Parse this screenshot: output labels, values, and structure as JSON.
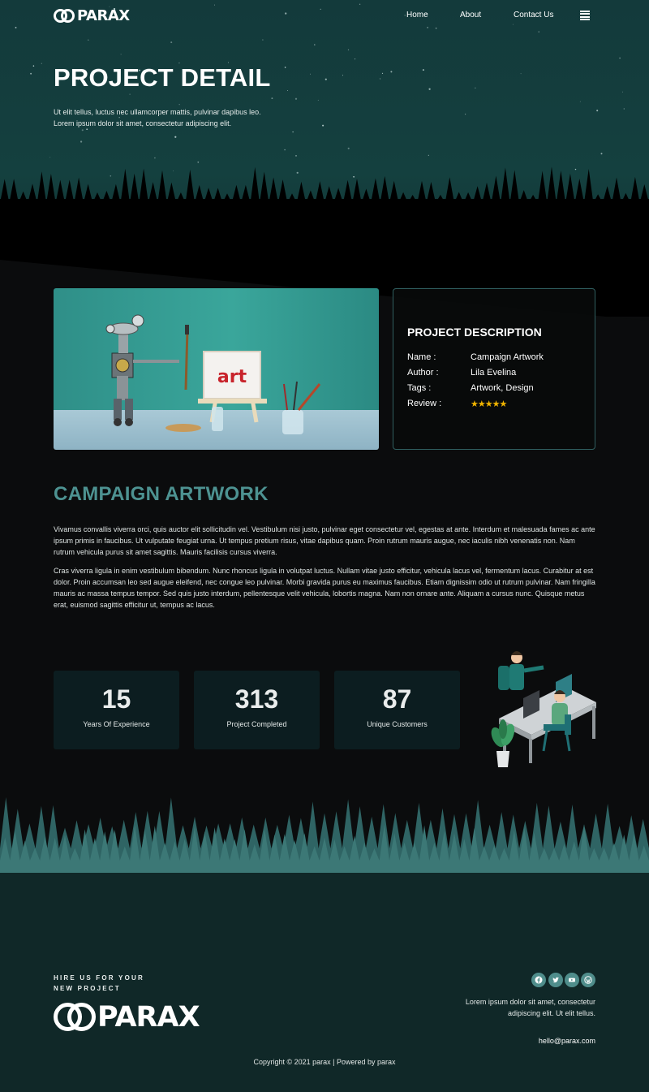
{
  "brand": {
    "name": "PARAX"
  },
  "nav": {
    "items": [
      "Home",
      "About",
      "Contact Us"
    ],
    "menu_icon": "hamburger-icon"
  },
  "hero": {
    "title": "PROJECT DETAIL",
    "subtitle_line1": "Ut elit tellus, luctus nec ullamcorper mattis, pulvinar dapibus leo.",
    "subtitle_line2": "Lorem ipsum dolor sit amet, consectetur adipiscing elit."
  },
  "project": {
    "image_text": "art",
    "description_title": "PROJECT DESCRIPTION",
    "rows": [
      {
        "key": "Name :",
        "value": "Campaign Artwork"
      },
      {
        "key": "Author :",
        "value": "Lila Evelina"
      },
      {
        "key": "Tags :",
        "value": "Artwork, Design"
      },
      {
        "key": "Review :",
        "value": "★★★★★"
      }
    ],
    "review_stars": 4.5
  },
  "article": {
    "title": "CAMPAIGN ARTWORK",
    "paragraphs": [
      "Vivamus convallis viverra orci, quis auctor elit sollicitudin vel. Vestibulum nisi justo, pulvinar eget consectetur vel, egestas at ante. Interdum et malesuada fames ac ante ipsum primis in faucibus. Ut vulputate feugiat urna. Ut tempus pretium risus, vitae dapibus quam. Proin rutrum mauris augue, nec iaculis nibh venenatis non. Nam rutrum vehicula purus sit amet sagittis. Mauris facilisis cursus viverra.",
      "Cras viverra ligula in enim vestibulum bibendum. Nunc rhoncus ligula in volutpat luctus. Nullam vitae justo efficitur, vehicula lacus vel, fermentum lacus. Curabitur at est dolor. Proin accumsan leo sed augue eleifend, nec congue leo pulvinar. Morbi gravida purus eu maximus faucibus. Etiam dignissim odio ut rutrum pulvinar. Nam fringilla mauris ac massa tempus tempor. Sed quis justo interdum, pellentesque velit vehicula, lobortis magna. Nam non ornare ante. Aliquam a cursus nunc. Quisque metus erat, euismod sagittis efficitur ut, tempus ac lacus."
    ]
  },
  "stats": [
    {
      "number": "15",
      "label": "Years Of Experience"
    },
    {
      "number": "313",
      "label": "Project Completed"
    },
    {
      "number": "87",
      "label": "Unique Customers"
    }
  ],
  "footer": {
    "hire_line1": "HIRE US FOR YOUR",
    "hire_line2": "NEW PROJECT",
    "logo_text": "PARAX",
    "social_icons": [
      "facebook-icon",
      "twitter-icon",
      "youtube-icon",
      "wordpress-icon"
    ],
    "text_line1": "Lorem ipsum dolor sit amet, consectetur",
    "text_line2": "adipiscing elit. Ut elit tellus.",
    "email": "hello@parax.com",
    "copyright": "Copyright © 2021 parax | Powered by parax"
  },
  "colors": {
    "accent_teal": "#4d9291",
    "hero_bg": "#133a3b",
    "footer_bg": "#102828",
    "star_gold": "#f0b400",
    "stat_card_bg": "#0c1d20"
  }
}
